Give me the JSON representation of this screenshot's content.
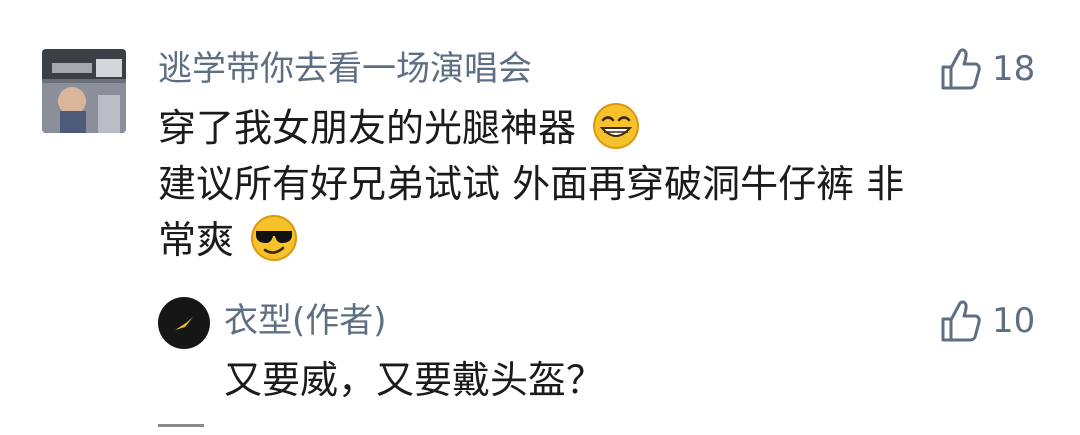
{
  "comment": {
    "username": "逃学带你去看一场演唱会",
    "likes": "18",
    "lines": [
      "穿了我女朋友的光腿神器",
      "建议所有好兄弟试试 外面再穿破洞牛仔裤 非",
      "常爽"
    ],
    "emojis": [
      "grinning-face-emoji",
      "sunglasses-face-emoji"
    ]
  },
  "reply": {
    "username": "衣型(作者)",
    "likes": "10",
    "text": "又要威，又要戴头盔？"
  },
  "colors": {
    "meta_text": "#5f6f83",
    "body_text": "#1b1b1b",
    "avatar_reply_bg": "#161616",
    "avatar_reply_mark": "#f2c21b"
  }
}
